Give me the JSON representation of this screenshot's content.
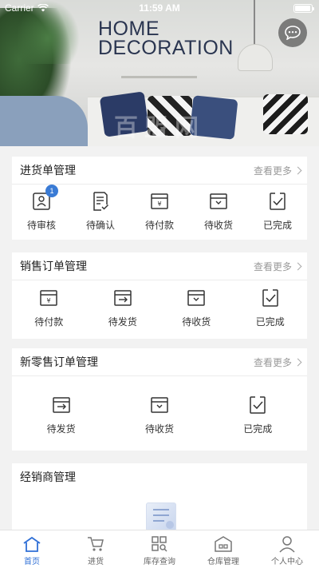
{
  "status_bar": {
    "carrier": "Carrier",
    "time": "11:59 AM",
    "battery_level": 0.95
  },
  "banner": {
    "title_line1": "HOME",
    "title_line2": "DECORATION",
    "watermark": "百盟网"
  },
  "sections": [
    {
      "title": "进货单管理",
      "more_label": "查看更多",
      "items": [
        {
          "label": "待审核",
          "icon": "review-icon",
          "badge": "1"
        },
        {
          "label": "待确认",
          "icon": "confirm-list-icon"
        },
        {
          "label": "待付款",
          "icon": "yen-box-icon"
        },
        {
          "label": "待收货",
          "icon": "receive-box-icon"
        },
        {
          "label": "已完成",
          "icon": "check-doc-icon"
        }
      ]
    },
    {
      "title": "销售订单管理",
      "more_label": "查看更多",
      "items": [
        {
          "label": "待付款",
          "icon": "yen-box-icon"
        },
        {
          "label": "待发货",
          "icon": "ship-box-icon"
        },
        {
          "label": "待收货",
          "icon": "receive-box-icon"
        },
        {
          "label": "已完成",
          "icon": "check-doc-icon"
        }
      ]
    },
    {
      "title": "新零售订单管理",
      "more_label": "查看更多",
      "items": [
        {
          "label": "待发货",
          "icon": "ship-box-icon"
        },
        {
          "label": "待收货",
          "icon": "receive-box-icon"
        },
        {
          "label": "已完成",
          "icon": "check-doc-icon"
        }
      ]
    },
    {
      "title": "经销商管理"
    }
  ],
  "tabbar": [
    {
      "label": "首页",
      "icon": "home-icon",
      "active": true
    },
    {
      "label": "进货",
      "icon": "cart-icon"
    },
    {
      "label": "库存查询",
      "icon": "grid-search-icon"
    },
    {
      "label": "仓库管理",
      "icon": "warehouse-icon"
    },
    {
      "label": "个人中心",
      "icon": "user-icon"
    }
  ],
  "colors": {
    "accent": "#2f6fd6",
    "badge": "#3a7bd5",
    "background": "#f2f2f2"
  }
}
